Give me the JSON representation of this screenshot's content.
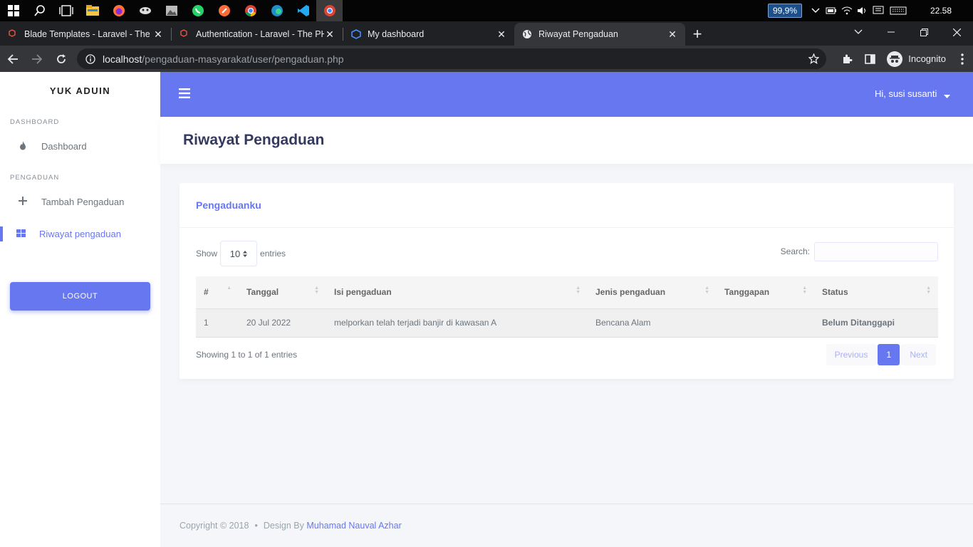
{
  "taskbar": {
    "battery": "99,9%",
    "time": "22.58"
  },
  "browser": {
    "tabs": [
      {
        "title": "Blade Templates - Laravel - The P"
      },
      {
        "title": "Authentication - Laravel - The PH"
      },
      {
        "title": "My dashboard"
      },
      {
        "title": "Riwayat Pengaduan"
      }
    ],
    "url_host": "localhost",
    "url_path": "/pengaduan-masyarakat/user/pengaduan.php",
    "incognito_label": "Incognito"
  },
  "sidebar": {
    "brand": "YUK ADUIN",
    "sections": [
      {
        "header": "DASHBOARD",
        "items": [
          {
            "label": "Dashboard",
            "icon": "fire-icon"
          }
        ]
      },
      {
        "header": "PENGADUAN",
        "items": [
          {
            "label": "Tambah Pengaduan",
            "icon": "plus-icon"
          },
          {
            "label": "Riwayat pengaduan",
            "icon": "grid-icon",
            "active": true
          }
        ]
      }
    ],
    "logout": "LOGOUT"
  },
  "header": {
    "user_greeting": "Hi, susi susanti"
  },
  "page": {
    "title": "Riwayat Pengaduan",
    "card_title": "Pengaduanku",
    "show_label": "Show",
    "entries_value": "10",
    "entries_label": "entries",
    "search_label": "Search:",
    "search_value": "",
    "columns": [
      "#",
      "Tanggal",
      "Isi pengaduan",
      "Jenis pengaduan",
      "Tanggapan",
      "Status"
    ],
    "rows": [
      {
        "no": "1",
        "tanggal": "20 Jul 2022",
        "isi": "melporkan telah terjadi banjir di kawasan A",
        "jenis": "Bencana Alam",
        "tanggapan": "",
        "status": "Belum Ditanggapi"
      }
    ],
    "info": "Showing 1 to 1 of 1 entries",
    "pagination": {
      "previous": "Previous",
      "current": "1",
      "next": "Next"
    }
  },
  "footer": {
    "copyright": "Copyright © 2018",
    "design_by": "Design By",
    "author": "Muhamad Nauval Azhar"
  },
  "colors": {
    "primary": "#6777ef",
    "danger": "#fc544b"
  }
}
